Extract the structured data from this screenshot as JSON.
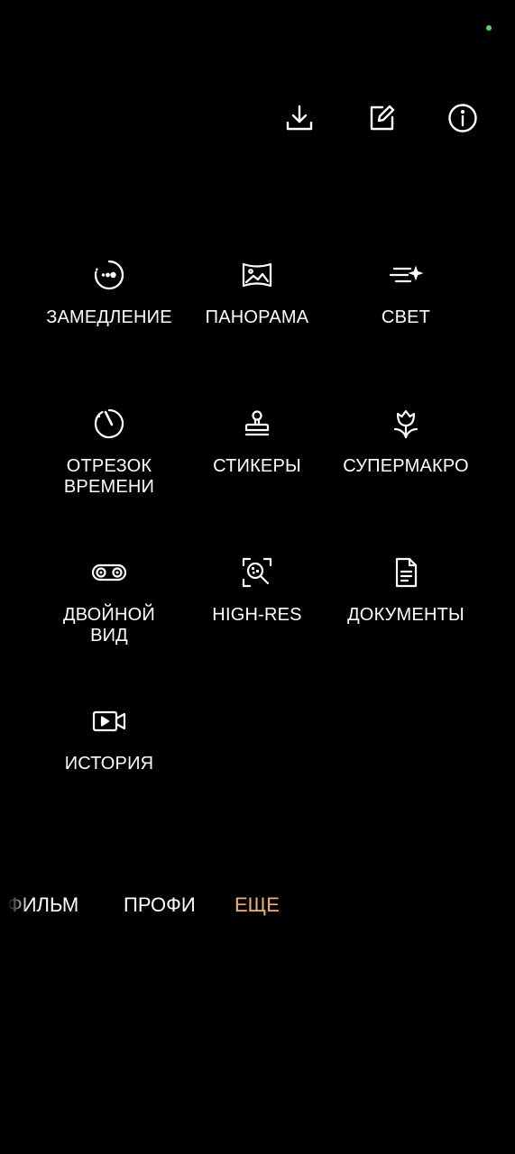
{
  "status": {
    "indicator_color": "#4cd964"
  },
  "top_actions": [
    {
      "name": "download-icon"
    },
    {
      "name": "edit-icon"
    },
    {
      "name": "info-icon"
    }
  ],
  "modes": [
    {
      "label": "ЗАМЕДЛЕНИЕ",
      "icon": "slow-motion-icon"
    },
    {
      "label": "ПАНОРАМА",
      "icon": "panorama-icon"
    },
    {
      "label": "СВЕТ",
      "icon": "light-painting-icon"
    },
    {
      "label": "ОТРЕЗОК\nВРЕМЕНИ",
      "icon": "time-lapse-icon"
    },
    {
      "label": "СТИКЕРЫ",
      "icon": "stamp-icon"
    },
    {
      "label": "СУПЕРМАКРО",
      "icon": "macro-flower-icon"
    },
    {
      "label": "ДВОЙНОЙ\nВИД",
      "icon": "dual-view-icon"
    },
    {
      "label": "HIGH-RES",
      "icon": "high-res-icon"
    },
    {
      "label": "ДОКУМЕНТЫ",
      "icon": "document-icon"
    },
    {
      "label": "ИСТОРИЯ",
      "icon": "video-story-icon"
    }
  ],
  "tabs": [
    {
      "label": "ФИЛЬМ"
    },
    {
      "label": "ПРОФИ"
    },
    {
      "label": "ЕЩЕ",
      "active": true
    }
  ],
  "colors": {
    "background": "#000000",
    "text": "#ffffff",
    "accent": "#f5b367"
  }
}
